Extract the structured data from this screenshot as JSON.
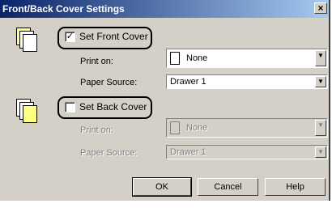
{
  "window": {
    "title": "Front/Back Cover Settings",
    "close_glyph": "×"
  },
  "front": {
    "checkbox_label": "Set Front Cover",
    "checked": true,
    "check_glyph": "✓",
    "print_on_label": "Print on:",
    "print_on_value": "None",
    "paper_source_label": "Paper Source:",
    "paper_source_value": "Drawer 1"
  },
  "back": {
    "checkbox_label": "Set Back Cover",
    "checked": false,
    "print_on_label": "Print on:",
    "print_on_value": "None",
    "paper_source_label": "Paper Source:",
    "paper_source_value": "Drawer 1"
  },
  "buttons": {
    "ok": "OK",
    "cancel": "Cancel",
    "help": "Help"
  },
  "icons": {
    "dropdown_arrow": "▼",
    "stack_front": "page-stack-yellow-front-icon",
    "stack_back": "page-stack-yellow-back-icon"
  }
}
